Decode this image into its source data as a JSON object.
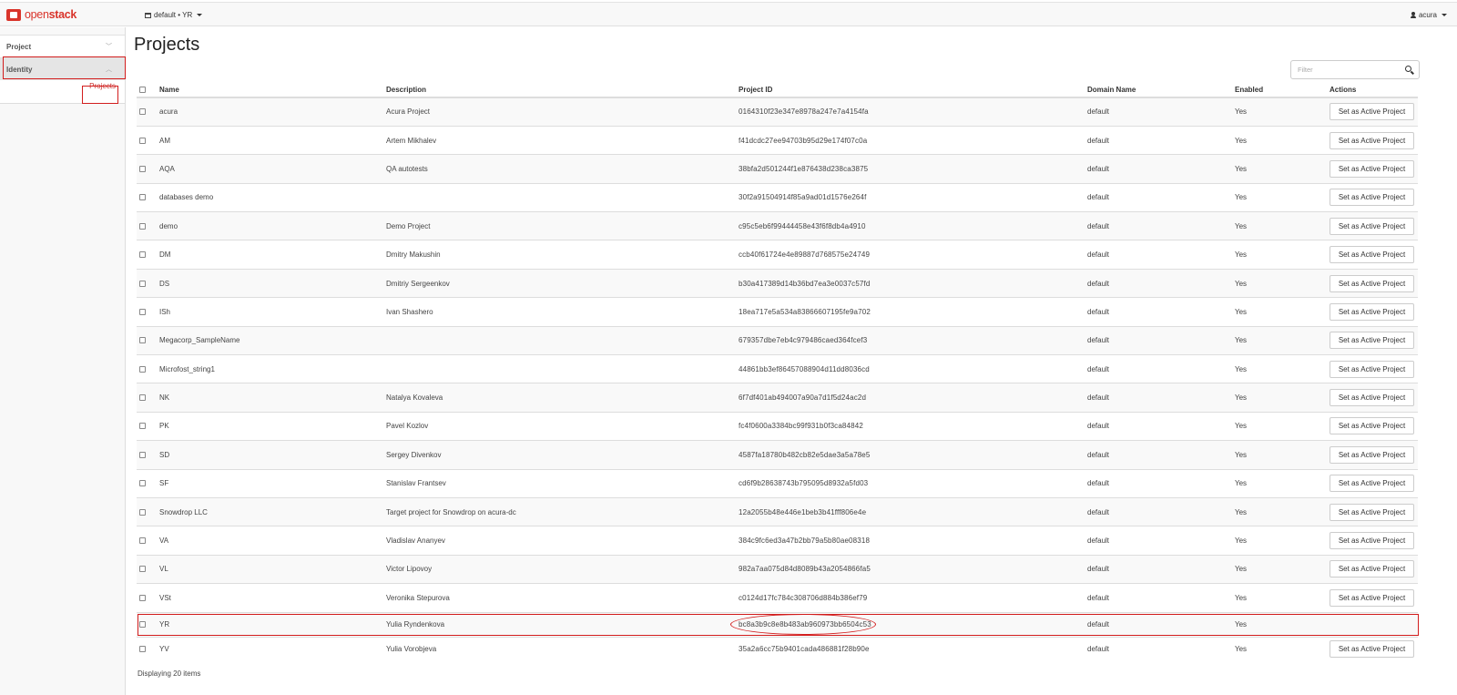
{
  "navbar": {
    "brand_open": "open",
    "brand_stack": "stack",
    "context_label": "default • YR",
    "user_label": "acura"
  },
  "sidebar": {
    "items": [
      {
        "label": "Project",
        "chevron": "﹀"
      },
      {
        "label": "Identity",
        "chevron": "︿"
      }
    ],
    "sub_link": "Projects"
  },
  "main": {
    "title": "Projects",
    "filter_placeholder": "Filter",
    "columns": [
      "Name",
      "Description",
      "Project ID",
      "Domain Name",
      "Enabled",
      "Actions"
    ],
    "action_label": "Set as Active Project",
    "rows": [
      {
        "name": "acura",
        "description": "Acura Project",
        "id": "0164310f23e347e8978a247e7a4154fa",
        "domain": "default",
        "enabled": "Yes",
        "has_action": true
      },
      {
        "name": "AM",
        "description": "Artem Mikhalev",
        "id": "f41dcdc27ee94703b95d29e174f07c0a",
        "domain": "default",
        "enabled": "Yes",
        "has_action": true
      },
      {
        "name": "AQA",
        "description": "QA autotests",
        "id": "38bfa2d501244f1e876438d238ca3875",
        "domain": "default",
        "enabled": "Yes",
        "has_action": true
      },
      {
        "name": "databases demo",
        "description": "",
        "id": "30f2a91504914f85a9ad01d1576e264f",
        "domain": "default",
        "enabled": "Yes",
        "has_action": true
      },
      {
        "name": "demo",
        "description": "Demo Project",
        "id": "c95c5eb6f99444458e43f6f8db4a4910",
        "domain": "default",
        "enabled": "Yes",
        "has_action": true
      },
      {
        "name": "DM",
        "description": "Dmitry Makushin",
        "id": "ccb40f61724e4e89887d768575e24749",
        "domain": "default",
        "enabled": "Yes",
        "has_action": true
      },
      {
        "name": "DS",
        "description": "Dmitriy Sergeenkov",
        "id": "b30a417389d14b36bd7ea3e0037c57fd",
        "domain": "default",
        "enabled": "Yes",
        "has_action": true
      },
      {
        "name": "ISh",
        "description": "Ivan Shashero",
        "id": "18ea717e5a534a83866607195fe9a702",
        "domain": "default",
        "enabled": "Yes",
        "has_action": true
      },
      {
        "name": "Megacorp_SampleName",
        "description": "",
        "id": "679357dbe7eb4c979486caed364fcef3",
        "domain": "default",
        "enabled": "Yes",
        "has_action": true
      },
      {
        "name": "Microfost_string1",
        "description": "",
        "id": "44861bb3ef86457088904d11dd8036cd",
        "domain": "default",
        "enabled": "Yes",
        "has_action": true
      },
      {
        "name": "NK",
        "description": "Natalya Kovaleva",
        "id": "6f7df401ab494007a90a7d1f5d24ac2d",
        "domain": "default",
        "enabled": "Yes",
        "has_action": true
      },
      {
        "name": "PK",
        "description": "Pavel Kozlov",
        "id": "fc4f0600a3384bc99f931b0f3ca84842",
        "domain": "default",
        "enabled": "Yes",
        "has_action": true
      },
      {
        "name": "SD",
        "description": "Sergey Divenkov",
        "id": "4587fa18780b482cb82e5dae3a5a78e5",
        "domain": "default",
        "enabled": "Yes",
        "has_action": true
      },
      {
        "name": "SF",
        "description": "Stanislav Frantsev",
        "id": "cd6f9b28638743b795095d8932a5fd03",
        "domain": "default",
        "enabled": "Yes",
        "has_action": true
      },
      {
        "name": "Snowdrop LLC",
        "description": "Target project for Snowdrop on acura-dc",
        "id": "12a2055b48e446e1beb3b41fff806e4e",
        "domain": "default",
        "enabled": "Yes",
        "has_action": true
      },
      {
        "name": "VA",
        "description": "Vladislav Ananyev",
        "id": "384c9fc6ed3a47b2bb79a5b80ae08318",
        "domain": "default",
        "enabled": "Yes",
        "has_action": true
      },
      {
        "name": "VL",
        "description": "Victor Lipovoy",
        "id": "982a7aa075d84d8089b43a2054866fa5",
        "domain": "default",
        "enabled": "Yes",
        "has_action": true
      },
      {
        "name": "VSt",
        "description": "Veronika Stepurova",
        "id": "c0124d17fc784c308706d884b386ef79",
        "domain": "default",
        "enabled": "Yes",
        "has_action": true
      },
      {
        "name": "YR",
        "description": "Yulia Ryndenkova",
        "id": "bc8a3b9c8e8b483ab960973bb6504c53",
        "domain": "default",
        "enabled": "Yes",
        "has_action": false
      },
      {
        "name": "YV",
        "description": "Yulia Vorobjeva",
        "id": "35a2a6cc75b9401cada486881f28b90e",
        "domain": "default",
        "enabled": "Yes",
        "has_action": true
      }
    ],
    "footer": "Displaying 20 items"
  },
  "colors": {
    "brand": "#d9342b",
    "highlight": "#d21d1d",
    "link_active": "#c9302c"
  }
}
